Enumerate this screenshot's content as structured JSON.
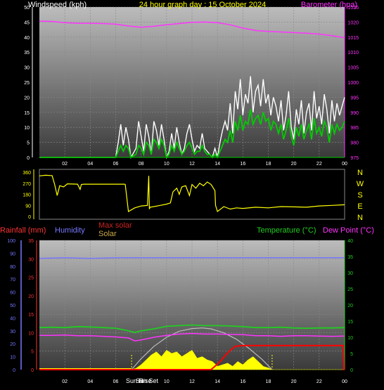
{
  "header": {
    "title": "24 hour graph day : 15 October 2024",
    "wind_label": "Windspeed (kph)",
    "baro_label": "Barometer (hpa)"
  },
  "colors": {
    "title": "#ffff00",
    "wind_gust": "#ffffff",
    "wind_avg": "#00cc00",
    "wind_avg_light": "#bbf0bb",
    "barometer": "#ff33ff",
    "direction": "#ffff00",
    "rain_axis": "#ff3333",
    "humidity": "#7777ff",
    "temperature": "#22cc22",
    "dewpoint": "#ff33ff",
    "max_solar": "#bbbbbb",
    "solar": "#ffff00",
    "rain_line": "#ff0000",
    "plot_bg_top": "#bcbcbc",
    "plot_bg_bottom": "#3a3a3a"
  },
  "lower_legend": {
    "rainfall": "Rainfall (mm)",
    "humidity": "Humidity",
    "max_solar": "Max solar",
    "solar": "Solar",
    "temperature": "Temperature (°C)",
    "dewpoint": "Dew Point (°C)",
    "sunrise": "Sun Rise",
    "sunset": "Sun Set"
  },
  "compass_labels": [
    "N",
    "W",
    "S",
    "E",
    "N"
  ],
  "chart_data": [
    {
      "type": "line",
      "title": "24 hour graph day : 15 October 2024",
      "x_ticks": [
        "02",
        "04",
        "06",
        "08",
        "10",
        "12",
        "14",
        "16",
        "18",
        "20",
        "22",
        "00"
      ],
      "xlim": [
        0,
        24
      ],
      "ylabel": "Windspeed (kph)",
      "y2label": "Barometer (hpa)",
      "ylim": [
        0,
        50
      ],
      "y_ticks": [
        0,
        5,
        10,
        15,
        20,
        25,
        30,
        35,
        40,
        45,
        50
      ],
      "y2lim": [
        975,
        1025
      ],
      "y2_ticks": [
        975,
        980,
        985,
        990,
        995,
        1000,
        1005,
        1010,
        1015,
        1020,
        1025
      ],
      "series": [
        {
          "name": "Barometer (hpa)",
          "axis": "right",
          "x": [
            0,
            1,
            2,
            3,
            4,
            5,
            6,
            7,
            8,
            9,
            10,
            11,
            12,
            13,
            14,
            15,
            16,
            17,
            18,
            19,
            20,
            21,
            22,
            23,
            24
          ],
          "values": [
            1020.3,
            1020.2,
            1019.8,
            1019.6,
            1019.6,
            1019.5,
            1019.3,
            1018.7,
            1018.3,
            1018.6,
            1019.1,
            1019.5,
            1019.9,
            1020.0,
            1019.8,
            1019.1,
            1018.0,
            1017.2,
            1016.9,
            1016.7,
            1016.5,
            1016.3,
            1016.0,
            1015.5,
            1014.8
          ]
        },
        {
          "name": "Wind gust (kph)",
          "axis": "left",
          "x": [
            0,
            6.0,
            6.2,
            6.4,
            6.6,
            6.8,
            7.0,
            7.2,
            7.6,
            7.8,
            8.0,
            8.2,
            8.4,
            8.6,
            8.8,
            9.0,
            9.2,
            9.4,
            9.6,
            9.8,
            10.0,
            10.2,
            10.4,
            10.6,
            10.8,
            11.0,
            11.2,
            11.4,
            11.6,
            11.8,
            12.0,
            12.2,
            12.4,
            12.6,
            12.8,
            13.0,
            13.2,
            13.4,
            13.6,
            13.8,
            14.0,
            14.2,
            14.4,
            14.6,
            14.8,
            15.0,
            15.2,
            15.4,
            15.6,
            15.8,
            16.0,
            16.2,
            16.4,
            16.6,
            16.8,
            17.0,
            17.2,
            17.4,
            17.6,
            17.8,
            18.0,
            18.2,
            18.4,
            18.6,
            18.8,
            19.0,
            19.2,
            19.4,
            19.6,
            19.8,
            20.0,
            20.2,
            20.4,
            20.6,
            20.8,
            21.0,
            21.2,
            21.4,
            21.6,
            21.8,
            22.0,
            22.2,
            22.4,
            22.6,
            22.8,
            23.0,
            23.2,
            23.4,
            23.6,
            23.8,
            24.0
          ],
          "values": [
            0,
            0,
            5,
            11,
            4,
            10,
            6,
            0,
            3,
            12,
            7,
            2,
            11,
            7,
            1,
            12,
            9,
            4,
            11,
            6,
            0,
            2,
            8,
            3,
            10,
            5,
            1,
            3,
            8,
            11,
            6,
            2,
            4,
            3,
            8,
            3,
            2,
            1,
            0,
            3,
            0,
            5,
            9,
            12,
            9,
            18,
            8,
            22,
            16,
            26,
            14,
            21,
            18,
            27,
            15,
            22,
            24,
            17,
            26,
            18,
            21,
            14,
            20,
            17,
            12,
            19,
            9,
            14,
            22,
            10,
            6,
            16,
            11,
            19,
            8,
            15,
            18,
            9,
            22,
            13,
            17,
            11,
            21,
            16,
            8,
            19,
            12,
            18,
            14,
            17,
            20
          ]
        },
        {
          "name": "Wind average (kph)",
          "axis": "left",
          "x": [
            0,
            6.0,
            6.2,
            6.4,
            6.6,
            6.8,
            7.0,
            7.2,
            7.6,
            7.8,
            8.0,
            8.2,
            8.4,
            8.6,
            8.8,
            9.0,
            9.2,
            9.4,
            9.6,
            9.8,
            10.0,
            10.2,
            10.4,
            10.6,
            10.8,
            11.0,
            11.2,
            11.4,
            11.6,
            11.8,
            12.0,
            12.2,
            12.4,
            12.6,
            12.8,
            13.0,
            13.2,
            13.4,
            13.6,
            13.8,
            14.0,
            14.2,
            14.4,
            14.6,
            14.8,
            15.0,
            15.2,
            15.4,
            15.6,
            15.8,
            16.0,
            16.2,
            16.4,
            16.6,
            16.8,
            17.0,
            17.2,
            17.4,
            17.6,
            17.8,
            18.0,
            18.2,
            18.4,
            18.6,
            18.8,
            19.0,
            19.2,
            19.4,
            19.6,
            19.8,
            20.0,
            20.2,
            20.4,
            20.6,
            20.8,
            21.0,
            21.2,
            21.4,
            21.6,
            21.8,
            22.0,
            22.2,
            22.4,
            22.6,
            22.8,
            23.0,
            23.2,
            23.4,
            23.6,
            23.8,
            24.0
          ],
          "values": [
            0,
            0,
            2,
            4,
            2,
            4,
            3,
            0,
            1,
            4,
            3,
            1,
            5,
            4,
            1,
            6,
            5,
            3,
            6,
            4,
            0,
            1,
            4,
            2,
            5,
            3,
            1,
            2,
            4,
            5,
            3,
            1,
            2,
            2,
            4,
            2,
            1,
            1,
            0,
            1,
            0,
            2,
            4,
            6,
            5,
            9,
            5,
            12,
            9,
            14,
            9,
            12,
            11,
            16,
            11,
            13,
            14,
            11,
            15,
            12,
            13,
            9,
            12,
            11,
            8,
            11,
            6,
            9,
            13,
            7,
            4,
            10,
            7,
            11,
            6,
            9,
            11,
            6,
            13,
            8,
            10,
            7,
            12,
            10,
            5,
            11,
            8,
            11,
            9,
            10,
            12
          ]
        }
      ]
    },
    {
      "type": "line",
      "ylabel": "Wind direction",
      "ylim": [
        0,
        360
      ],
      "y_ticks": [
        0,
        90,
        180,
        270,
        360
      ],
      "xlim": [
        0,
        24
      ],
      "series": [
        {
          "name": "Wind direction",
          "x": [
            0,
            0.5,
            1.0,
            1.2,
            1.4,
            1.6,
            1.9,
            2.2,
            3.0,
            3.2,
            3.3,
            3.5,
            4.5,
            5.5,
            6.0,
            6.5,
            6.7,
            6.75,
            7.0,
            7.5,
            8.0,
            8.5,
            8.6,
            8.65,
            8.7,
            9.0,
            9.5,
            10.0,
            10.3,
            10.5,
            10.8,
            11.0,
            11.2,
            11.5,
            11.8,
            12.0,
            12.3,
            12.6,
            12.9,
            13.2,
            13.5,
            13.8,
            13.85,
            14.0,
            14.5,
            15.0,
            15.5,
            16.0,
            17.0,
            18.0,
            19.0,
            20.0,
            21.0,
            22.0,
            23.0,
            24.0
          ],
          "values": [
            330,
            335,
            332,
            260,
            170,
            250,
            240,
            265,
            262,
            220,
            260,
            262,
            262,
            262,
            262,
            262,
            262,
            260,
            40,
            70,
            85,
            90,
            330,
            60,
            75,
            80,
            90,
            100,
            110,
            200,
            230,
            180,
            240,
            250,
            170,
            260,
            230,
            270,
            250,
            280,
            260,
            210,
            90,
            40,
            80,
            60,
            70,
            65,
            75,
            70,
            80,
            78,
            75,
            85,
            90,
            95
          ]
        }
      ]
    },
    {
      "type": "line",
      "xlim": [
        0,
        24
      ],
      "x_ticks": [
        "02",
        "04",
        "06",
        "08",
        "10",
        "12",
        "14",
        "16",
        "18",
        "20",
        "22",
        "00"
      ],
      "ylabel": "Rainfall (mm)",
      "ylim": [
        0,
        35
      ],
      "y_ticks": [
        0,
        5,
        10,
        15,
        20,
        25,
        30,
        35
      ],
      "humidity_ylim": [
        0,
        100
      ],
      "humidity_ticks": [
        0,
        10,
        20,
        30,
        40,
        50,
        60,
        70,
        80,
        90,
        100
      ],
      "y2label": "Temperature (°C)",
      "y2lim": [
        0,
        40
      ],
      "y2_ticks": [
        0,
        5,
        10,
        15,
        20,
        25,
        30,
        35,
        40
      ],
      "sunrise_hour": 7.25,
      "sunset_hour": 18.3,
      "series": [
        {
          "name": "Humidity",
          "axis": "humidity",
          "x": [
            0,
            2,
            4,
            6,
            8,
            10,
            12,
            14,
            16,
            18,
            20,
            22,
            24
          ],
          "values": [
            86,
            86.5,
            86,
            86.5,
            86.5,
            86.5,
            86.5,
            86.5,
            86.5,
            86.5,
            86.5,
            86.5,
            86.5
          ]
        },
        {
          "name": "Temperature (°C)",
          "axis": "right",
          "x": [
            0,
            1,
            2,
            3,
            4,
            5,
            6,
            7,
            7.5,
            8,
            9,
            10,
            11,
            12,
            13,
            14,
            15,
            16,
            17,
            18,
            19,
            20,
            21,
            22,
            23,
            24
          ],
          "values": [
            13.0,
            13.1,
            13.0,
            13.3,
            13.2,
            13.0,
            12.8,
            12.0,
            11.5,
            12.0,
            12.6,
            13.4,
            13.6,
            13.8,
            13.6,
            13.6,
            13.5,
            13.3,
            13.0,
            13.0,
            13.1,
            12.9,
            12.8,
            12.9,
            12.9,
            13.0
          ]
        },
        {
          "name": "Dew Point (°C)",
          "axis": "right",
          "x": [
            0,
            1,
            2,
            3,
            4,
            5,
            6,
            7,
            7.5,
            8,
            9,
            10,
            11,
            12,
            13,
            14,
            15,
            16,
            17,
            18,
            19,
            20,
            21,
            22,
            23,
            24
          ],
          "values": [
            10.6,
            10.6,
            10.7,
            10.5,
            10.5,
            10.3,
            10.1,
            9.8,
            8.9,
            9.2,
            10.0,
            10.6,
            11.0,
            11.2,
            11.0,
            11.0,
            10.9,
            10.8,
            10.5,
            10.5,
            10.3,
            10.5,
            10.5,
            10.4,
            10.3,
            10.4
          ]
        },
        {
          "name": "Rainfall (mm)",
          "axis": "left",
          "x": [
            0,
            13.5,
            14.0,
            14.3,
            14.6,
            15.0,
            15.4,
            16.0,
            17.0,
            18.0,
            19.0,
            20.0,
            21.0,
            22.0,
            23.0,
            23.9,
            23.95,
            24.0
          ],
          "values": [
            0,
            0,
            1.5,
            2.5,
            3.8,
            5.2,
            6.3,
            6.5,
            6.5,
            6.5,
            6.5,
            6.5,
            6.5,
            6.5,
            6.5,
            6.5,
            0,
            0
          ]
        },
        {
          "name": "Max solar",
          "axis": "right",
          "x": [
            7.25,
            8,
            9,
            10,
            11,
            12,
            12.8,
            13.5,
            14.5,
            15.5,
            16.5,
            17.5,
            18.3
          ],
          "values": [
            0,
            3.4,
            7.2,
            10.0,
            11.9,
            12.7,
            12.9,
            12.6,
            11.4,
            9.4,
            6.5,
            3.2,
            0
          ]
        },
        {
          "name": "Solar",
          "axis": "right",
          "x": [
            0,
            7.2,
            7.6,
            8.0,
            8.4,
            8.8,
            9.2,
            9.6,
            10.0,
            10.4,
            10.8,
            11.2,
            11.6,
            12.0,
            12.4,
            12.8,
            13.2,
            13.6,
            14.0,
            14.4,
            14.8,
            15.2,
            15.6,
            16.0,
            16.4,
            16.8,
            17.2,
            17.6,
            18.0,
            18.3,
            24.0
          ],
          "values": [
            0,
            0,
            0.4,
            1.5,
            3.0,
            4.5,
            5.5,
            4.0,
            6.0,
            5.0,
            5.5,
            4.0,
            5.0,
            6.0,
            3.5,
            4.0,
            3.0,
            2.5,
            1.0,
            1.5,
            2.0,
            1.0,
            2.5,
            1.5,
            3.0,
            4.0,
            2.5,
            1.0,
            0.5,
            0,
            0
          ]
        }
      ]
    }
  ]
}
